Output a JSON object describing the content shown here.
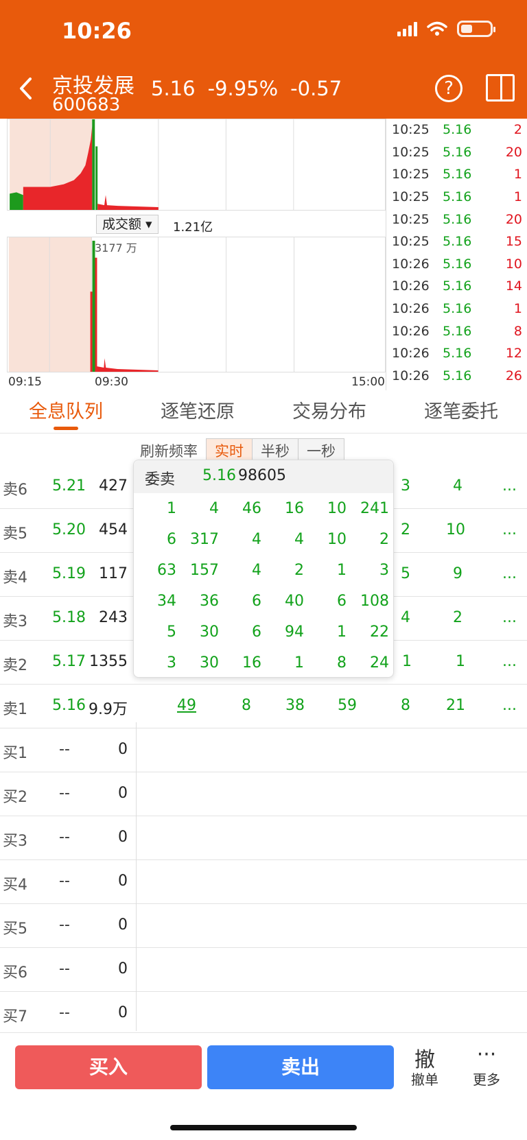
{
  "status_bar": {
    "time": "10:26"
  },
  "header": {
    "back_icon": "chevron-left-icon",
    "stock_name": "京投发展",
    "stock_code": "600683",
    "price": "5.16",
    "change_pct": "-9.95%",
    "change": "-0.57",
    "help_icon": "question-circle-icon",
    "switch_icon": "layout-switch-icon"
  },
  "chart": {
    "volume_selector": "成交额",
    "volume_value": "1.21亿",
    "volume_max": "3177 万",
    "time_labels": [
      "09:15",
      "09:30",
      "15:00"
    ]
  },
  "ticks": [
    {
      "time": "10:25",
      "price": "5.16",
      "vol": "2"
    },
    {
      "time": "10:25",
      "price": "5.16",
      "vol": "20"
    },
    {
      "time": "10:25",
      "price": "5.16",
      "vol": "1"
    },
    {
      "time": "10:25",
      "price": "5.16",
      "vol": "1"
    },
    {
      "time": "10:25",
      "price": "5.16",
      "vol": "20"
    },
    {
      "time": "10:25",
      "price": "5.16",
      "vol": "15"
    },
    {
      "time": "10:26",
      "price": "5.16",
      "vol": "10"
    },
    {
      "time": "10:26",
      "price": "5.16",
      "vol": "14"
    },
    {
      "time": "10:26",
      "price": "5.16",
      "vol": "1"
    },
    {
      "time": "10:26",
      "price": "5.16",
      "vol": "8"
    },
    {
      "time": "10:26",
      "price": "5.16",
      "vol": "12"
    },
    {
      "time": "10:26",
      "price": "5.16",
      "vol": "26"
    }
  ],
  "tabs": [
    "全息队列",
    "逐笔还原",
    "交易分布",
    "逐笔委托"
  ],
  "refresh": {
    "label": "刷新频率",
    "options": [
      "实时",
      "半秒",
      "一秒"
    ]
  },
  "book": {
    "sell": [
      {
        "label": "卖6",
        "price": "5.21",
        "qty": "427",
        "q": [
          "3",
          "4",
          "..."
        ]
      },
      {
        "label": "卖5",
        "price": "5.20",
        "qty": "454",
        "q": [
          "2",
          "10",
          "..."
        ]
      },
      {
        "label": "卖4",
        "price": "5.19",
        "qty": "117",
        "q": [
          "5",
          "9",
          "..."
        ]
      },
      {
        "label": "卖3",
        "price": "5.18",
        "qty": "243",
        "q": [
          "4",
          "2",
          "..."
        ]
      },
      {
        "label": "卖2",
        "price": "5.17",
        "qty": "1355",
        "q": [
          "1",
          "1",
          "..."
        ]
      },
      {
        "label": "卖1",
        "price": "5.16",
        "qty": "9.9万",
        "q": [
          "49",
          "8",
          "38",
          "59",
          "8",
          "21",
          "..."
        ]
      }
    ],
    "buy": [
      {
        "label": "买1",
        "price": "--",
        "qty": "0"
      },
      {
        "label": "买2",
        "price": "--",
        "qty": "0"
      },
      {
        "label": "买3",
        "price": "--",
        "qty": "0"
      },
      {
        "label": "买4",
        "price": "--",
        "qty": "0"
      },
      {
        "label": "买5",
        "price": "--",
        "qty": "0"
      },
      {
        "label": "买6",
        "price": "--",
        "qty": "0"
      },
      {
        "label": "买7",
        "price": "--",
        "qty": "0"
      }
    ]
  },
  "popup": {
    "label": "委卖",
    "price": "5.16",
    "total": "98605",
    "rows": [
      [
        "1",
        "4",
        "46",
        "16",
        "10",
        "241"
      ],
      [
        "6",
        "317",
        "4",
        "4",
        "10",
        "2"
      ],
      [
        "63",
        "157",
        "4",
        "2",
        "1",
        "3"
      ],
      [
        "34",
        "36",
        "6",
        "40",
        "6",
        "108"
      ],
      [
        "5",
        "30",
        "6",
        "94",
        "1",
        "22"
      ],
      [
        "3",
        "30",
        "16",
        "1",
        "8",
        "24"
      ]
    ]
  },
  "bottom": {
    "buy": "买入",
    "sell": "卖出",
    "cancel_icon": "撤",
    "cancel_label": "撤单",
    "more_icon": "···",
    "more_label": "更多"
  },
  "colors": {
    "brand": "#e85a0c",
    "up": "#e0141e",
    "down": "#12a21b",
    "buy_btn": "#ef5a5a",
    "sell_btn": "#3d84f7"
  }
}
